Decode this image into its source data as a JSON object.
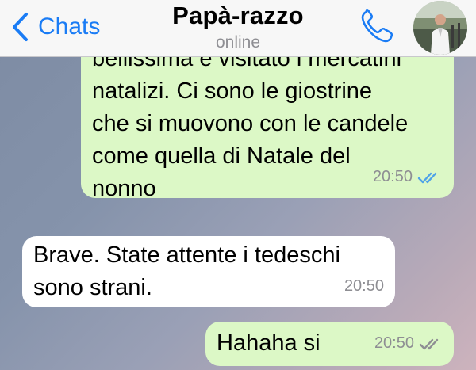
{
  "header": {
    "back_label": "Chats",
    "contact_name": "Papà-razzo",
    "status": "online",
    "icons": {
      "back": "chevron-left-icon",
      "call": "phone-icon"
    },
    "accent_color": "#1a7cf5"
  },
  "messages": [
    {
      "direction": "outgoing",
      "text": "bellissima e visitato i mercatini\nnatalizi. Ci sono le giostrine\nche si muovono con le candele\ncome quella di Natale del\nnonno",
      "time": "20:50",
      "ticks": "read"
    },
    {
      "direction": "incoming",
      "text": "Brave. State attente i tedeschi\nsono strani.",
      "time": "20:50"
    },
    {
      "direction": "outgoing",
      "text": "Hahaha si",
      "time": "20:50",
      "ticks": "delivered"
    }
  ],
  "colors": {
    "outgoing_bubble": "#dcf8c6",
    "incoming_bubble": "#ffffff",
    "read_ticks": "#4fa3e8",
    "delivered_ticks": "#8e8e93"
  }
}
